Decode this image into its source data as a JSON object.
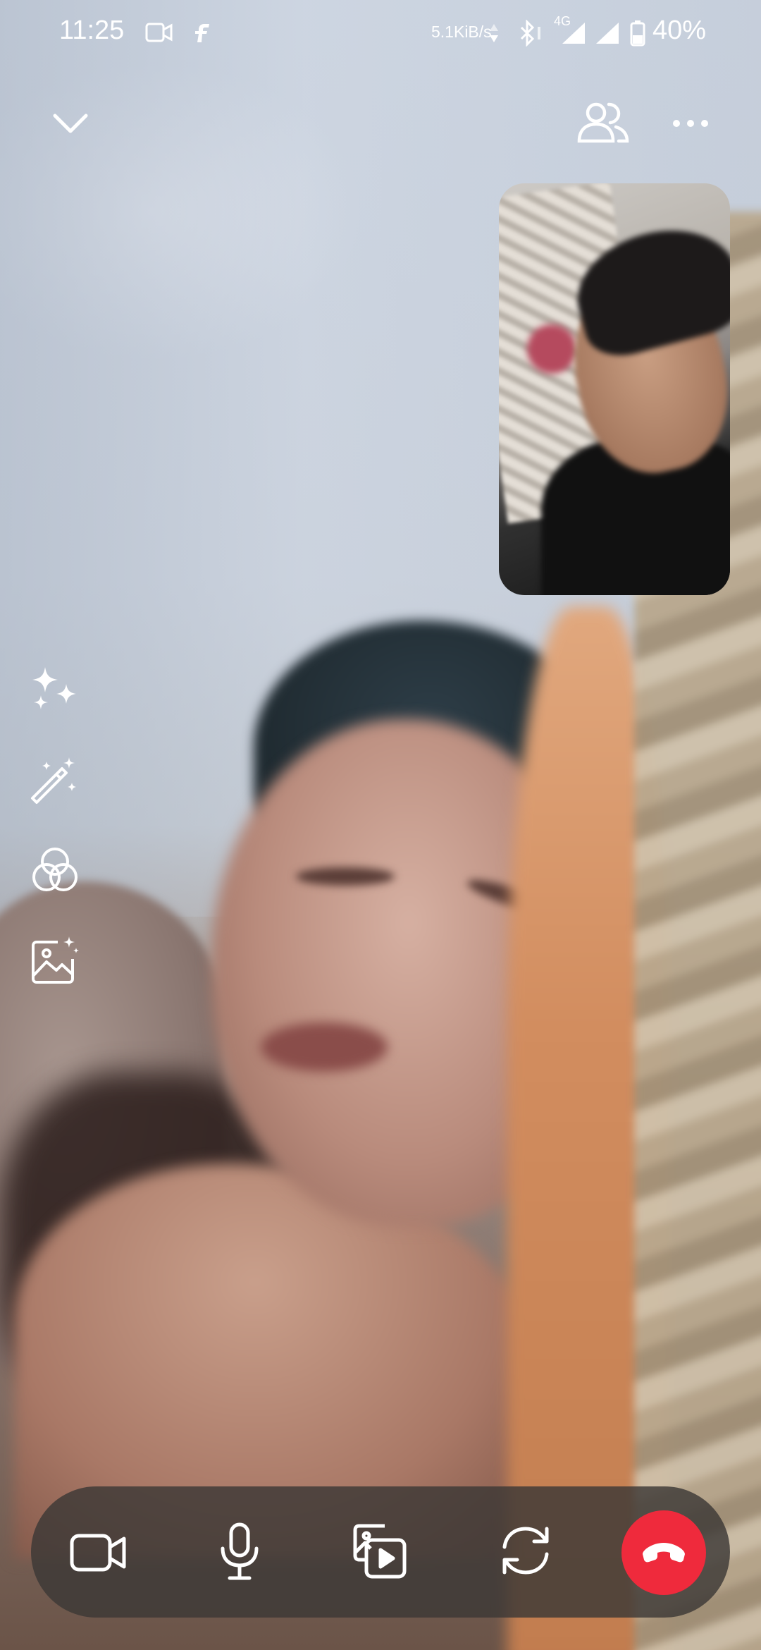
{
  "status_bar": {
    "time": "11:25",
    "network_speed": "5.1KiB/s",
    "network_type": "4G",
    "battery": "40%"
  },
  "top_controls": {
    "collapse_icon": "chevron-down-icon",
    "participants_icon": "people-icon",
    "more_icon": "more-horizontal-icon"
  },
  "side_tools": [
    {
      "icon": "sparkles-icon"
    },
    {
      "icon": "magic-wand-icon"
    },
    {
      "icon": "filters-icon"
    },
    {
      "icon": "background-image-icon"
    }
  ],
  "call_controls": [
    {
      "icon": "video-camera-icon"
    },
    {
      "icon": "microphone-icon"
    },
    {
      "icon": "share-media-icon"
    },
    {
      "icon": "flip-camera-icon"
    },
    {
      "icon": "end-call-icon",
      "color": "#ef2a3c"
    }
  ],
  "colors": {
    "control_bar": "#3c3836",
    "end_call": "#ef2a3c",
    "icon": "#ffffff"
  }
}
